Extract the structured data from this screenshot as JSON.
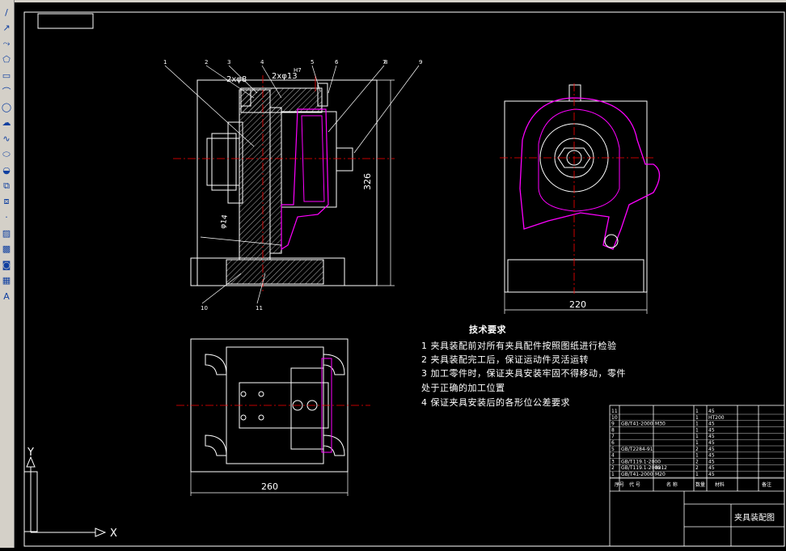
{
  "toolbar": {
    "tools": [
      {
        "name": "line-tool",
        "glyph": "/"
      },
      {
        "name": "construction-line-tool",
        "glyph": "↗"
      },
      {
        "name": "multiline-tool",
        "glyph": "⤳"
      },
      {
        "name": "polygon-tool",
        "glyph": "⬠"
      },
      {
        "name": "rectangle-tool",
        "glyph": "▭"
      },
      {
        "name": "arc-tool",
        "glyph": "⌒"
      },
      {
        "name": "circle-tool",
        "glyph": "◯"
      },
      {
        "name": "revision-cloud-tool",
        "glyph": "☁"
      },
      {
        "name": "spline-tool",
        "glyph": "∿"
      },
      {
        "name": "ellipse-tool",
        "glyph": "⬭"
      },
      {
        "name": "ellipse-arc-tool",
        "glyph": "◒"
      },
      {
        "name": "insert-block-tool",
        "glyph": "⧉"
      },
      {
        "name": "make-block-tool",
        "glyph": "⧈"
      },
      {
        "name": "point-tool",
        "glyph": "·"
      },
      {
        "name": "hatch-tool",
        "glyph": "▨"
      },
      {
        "name": "gradient-tool",
        "glyph": "▩"
      },
      {
        "name": "region-tool",
        "glyph": "◙"
      },
      {
        "name": "table-tool",
        "glyph": "▦"
      },
      {
        "name": "multiline-text-tool",
        "glyph": "A"
      }
    ]
  },
  "drawing": {
    "part_labels": [
      "1",
      "2",
      "3",
      "4",
      "5",
      "6",
      "7",
      "8",
      "9",
      "10",
      "11"
    ],
    "dim_height": "326",
    "dim_width_right": "220",
    "dim_width_bottom": "260",
    "tol_note_1": "2xφ8",
    "tol_note_2": "2xφ13",
    "fit_h7": "H7",
    "angle_note": "φ14",
    "requirements": {
      "title": "技术要求",
      "items": [
        "1  夹具装配前对所有夹具配件按照图纸进行检验",
        "2  夹具装配完工后，保证运动件灵活运转",
        "3  加工零件时，保证夹具安装牢固不得移动，零件",
        "    处于正确的加工位置",
        "4  保证夹具安装后的各形位公差要求"
      ]
    },
    "bom": {
      "rows": [
        [
          "11",
          "",
          "",
          "1",
          "45"
        ],
        [
          "10",
          "",
          "",
          "1",
          "HT200"
        ],
        [
          "9",
          "GB/T41-2000",
          "M30",
          "1",
          "45"
        ],
        [
          "8",
          "",
          "",
          "1",
          "45"
        ],
        [
          "7",
          "",
          "",
          "1",
          "45"
        ],
        [
          "6",
          "",
          "",
          "1",
          "45"
        ],
        [
          "5",
          "GB/T2284-91",
          "",
          "2",
          "45"
        ],
        [
          "4",
          "",
          "",
          "1",
          "45"
        ],
        [
          "3",
          "GB/T119.1-2000",
          "",
          "2",
          "45"
        ],
        [
          "2",
          "GB/T119.1-2000",
          "8x12",
          "2",
          "45"
        ],
        [
          "1",
          "GB/T41-2000",
          "M20",
          "1",
          "45"
        ]
      ],
      "header": [
        "序号",
        "代 号",
        "名 称",
        "数量",
        "材料",
        "备注"
      ],
      "title": "夹具装配图"
    },
    "ucs": {
      "x": "X",
      "y": "Y"
    }
  },
  "colors": {
    "magenta": "#ff00ff",
    "red": "#ff0000",
    "white": "#ffffff",
    "bg": "#000000"
  }
}
